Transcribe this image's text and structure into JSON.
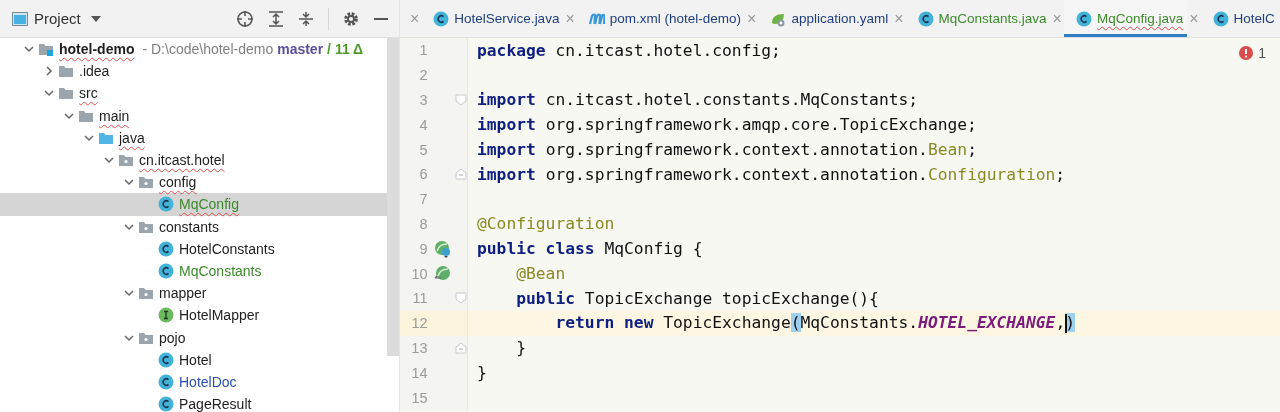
{
  "sidebar": {
    "title": "Project",
    "tree": [
      {
        "kind": "project",
        "label": "hotel-demo",
        "path": "- D:\\code\\hotel-demo",
        "branch": "master",
        "changes": "/ 11 Δ",
        "expanded": true,
        "selected": false,
        "misspelled": true,
        "color": "#1e1e1e",
        "children": [
          {
            "kind": "folder",
            "label": ".idea",
            "expanded": false,
            "selected": false,
            "misspelled": false,
            "color": "#1e1e1e"
          },
          {
            "kind": "folder",
            "label": "src",
            "expanded": true,
            "selected": false,
            "misspelled": true,
            "color": "#1e1e1e",
            "children": [
              {
                "kind": "folder",
                "label": "main",
                "expanded": true,
                "selected": false,
                "misspelled": true,
                "color": "#1e1e1e",
                "children": [
                  {
                    "kind": "source-root",
                    "label": "java",
                    "expanded": true,
                    "selected": false,
                    "misspelled": true,
                    "color": "#1e1e1e",
                    "children": [
                      {
                        "kind": "package",
                        "label": "cn.itcast.hotel",
                        "expanded": true,
                        "selected": false,
                        "misspelled": true,
                        "color": "#1e1e1e",
                        "children": [
                          {
                            "kind": "package",
                            "label": "config",
                            "expanded": true,
                            "selected": false,
                            "misspelled": true,
                            "color": "#1e1e1e",
                            "children": [
                              {
                                "kind": "class",
                                "label": "MqConfig",
                                "selected": true,
                                "misspelled": true,
                                "color": "#3c8a2b"
                              }
                            ]
                          },
                          {
                            "kind": "package",
                            "label": "constants",
                            "expanded": true,
                            "selected": false,
                            "misspelled": false,
                            "color": "#1e1e1e",
                            "children": [
                              {
                                "kind": "class",
                                "label": "HotelConstants",
                                "selected": false,
                                "misspelled": false,
                                "color": "#1e1e1e"
                              },
                              {
                                "kind": "class",
                                "label": "MqConstants",
                                "selected": false,
                                "misspelled": false,
                                "color": "#3c8a2b"
                              }
                            ]
                          },
                          {
                            "kind": "package",
                            "label": "mapper",
                            "expanded": true,
                            "selected": false,
                            "misspelled": false,
                            "color": "#1e1e1e",
                            "children": [
                              {
                                "kind": "interface",
                                "label": "HotelMapper",
                                "selected": false,
                                "misspelled": false,
                                "color": "#1e1e1e"
                              }
                            ]
                          },
                          {
                            "kind": "package",
                            "label": "pojo",
                            "expanded": true,
                            "selected": false,
                            "misspelled": false,
                            "color": "#1e1e1e",
                            "children": [
                              {
                                "kind": "class",
                                "label": "Hotel",
                                "selected": false,
                                "misspelled": false,
                                "color": "#1e1e1e"
                              },
                              {
                                "kind": "class",
                                "label": "HotelDoc",
                                "selected": false,
                                "misspelled": false,
                                "color": "#2c4fb0"
                              },
                              {
                                "kind": "class",
                                "label": "PageResult",
                                "selected": false,
                                "misspelled": false,
                                "color": "#1e1e1e"
                              }
                            ]
                          }
                        ]
                      }
                    ]
                  }
                ]
              }
            ]
          }
        ]
      }
    ]
  },
  "tab_bar": {
    "leading_close": "×",
    "tabs": [
      {
        "kind": "class",
        "label": "HotelService.java",
        "close": "×",
        "selected": false,
        "misspelled": false,
        "color": "#1f3f80"
      },
      {
        "kind": "maven",
        "label": "pom.xml (hotel-demo)",
        "close": "×",
        "selected": false,
        "misspelled": false,
        "color": "#1f3f80"
      },
      {
        "kind": "spring",
        "label": "application.yaml",
        "close": "×",
        "selected": false,
        "misspelled": false,
        "color": "#1f3f80"
      },
      {
        "kind": "class",
        "label": "MqConstants.java",
        "close": "×",
        "selected": false,
        "misspelled": false,
        "color": "#3c8a2b"
      },
      {
        "kind": "class",
        "label": "MqConfig.java",
        "close": "×",
        "selected": true,
        "misspelled": true,
        "color": "#3c8a2b"
      },
      {
        "kind": "class",
        "label": "HotelC",
        "selected": false,
        "misspelled": false,
        "color": "#1f3f80"
      }
    ]
  },
  "editor": {
    "problems": {
      "errors": "1"
    },
    "lines": [
      {
        "number": "1",
        "current": false,
        "kind": "plain",
        "tokens": [
          {
            "kind": "keyword",
            "text": "package"
          },
          {
            "kind": "plain",
            "text": " cn.itcast.hotel.config;"
          }
        ]
      },
      {
        "number": "2",
        "current": false,
        "kind": "plain"
      },
      {
        "number": "3",
        "current": false,
        "kind": "fold-start",
        "tokens": [
          {
            "kind": "keyword",
            "text": "import"
          },
          {
            "kind": "plain",
            "text": " cn.itcast.hotel.constants.MqConstants;"
          }
        ]
      },
      {
        "number": "4",
        "current": false,
        "kind": "plain",
        "tokens": [
          {
            "kind": "keyword",
            "text": "import"
          },
          {
            "kind": "plain",
            "text": " org.springframework.amqp.core.TopicExchange;"
          }
        ]
      },
      {
        "number": "5",
        "current": false,
        "kind": "plain",
        "tokens": [
          {
            "kind": "keyword",
            "text": "import"
          },
          {
            "kind": "plain",
            "text": " org.springframework.context.annotation."
          },
          {
            "kind": "annotation",
            "text": "Bean"
          },
          {
            "kind": "plain",
            "text": ";"
          }
        ]
      },
      {
        "number": "6",
        "current": false,
        "kind": "fold-end",
        "tokens": [
          {
            "kind": "keyword",
            "text": "import"
          },
          {
            "kind": "plain",
            "text": " org.springframework.context.annotation."
          },
          {
            "kind": "annotation",
            "text": "Configuration"
          },
          {
            "kind": "plain",
            "text": ";"
          }
        ]
      },
      {
        "number": "7",
        "current": false,
        "kind": "plain"
      },
      {
        "number": "8",
        "current": false,
        "kind": "plain",
        "tokens": [
          {
            "kind": "annotation",
            "text": "@Configuration"
          }
        ]
      },
      {
        "number": "9",
        "current": false,
        "kind": "bean-class",
        "tokens": [
          {
            "kind": "keyword",
            "text": "public class"
          },
          {
            "kind": "plain",
            "text": " MqConfig {"
          }
        ]
      },
      {
        "number": "10",
        "current": false,
        "kind": "bean-method",
        "tokens": [
          {
            "kind": "annotation",
            "text": "    @Bean"
          }
        ]
      },
      {
        "number": "11",
        "current": false,
        "kind": "fold-start",
        "tokens": [
          {
            "kind": "keyword",
            "text": "    public"
          },
          {
            "kind": "plain",
            "text": " TopicExchange topicExchange(){"
          }
        ]
      },
      {
        "number": "12",
        "current": true,
        "kind": "plain",
        "tokens": [
          {
            "kind": "keyword",
            "text": "        return new"
          },
          {
            "kind": "plain",
            "text": " TopicExchange"
          },
          {
            "kind": "match",
            "text": "("
          },
          {
            "kind": "plain",
            "text": "MqConstants."
          },
          {
            "kind": "constant",
            "text": "HOTEL_EXCHANGE"
          },
          {
            "kind": "plain",
            "text": ","
          },
          {
            "kind": "match",
            "text": ")",
            "caret": true
          }
        ]
      },
      {
        "number": "13",
        "current": false,
        "kind": "fold-end",
        "tokens": [
          {
            "kind": "plain",
            "text": "    }"
          }
        ]
      },
      {
        "number": "14",
        "current": false,
        "kind": "plain",
        "tokens": [
          {
            "kind": "plain",
            "text": "}"
          }
        ]
      },
      {
        "number": "15",
        "current": false,
        "kind": "plain"
      }
    ]
  }
}
